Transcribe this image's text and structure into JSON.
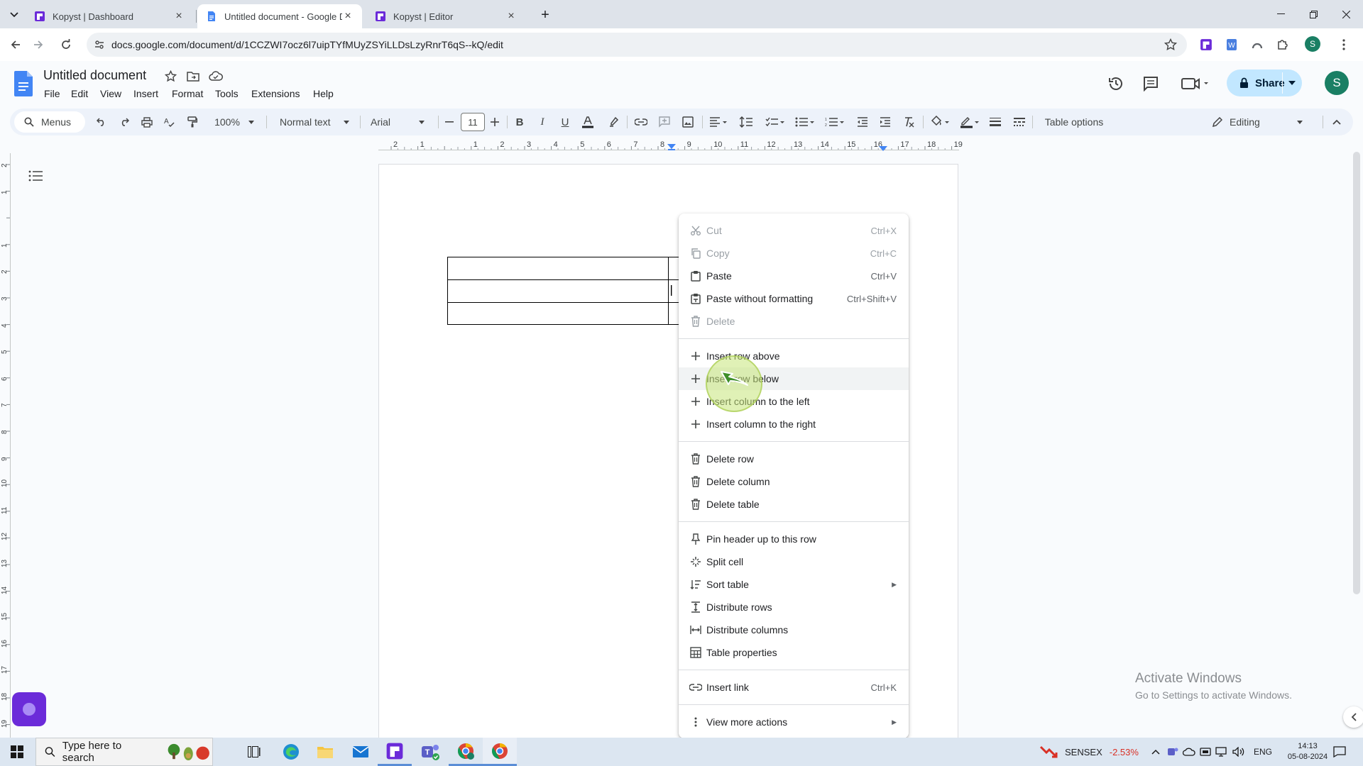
{
  "browser": {
    "tabs": [
      {
        "title": "Kopyst | Dashboard",
        "icon": "kopyst-icon",
        "active": false
      },
      {
        "title": "Untitled document - Google Docs",
        "icon": "google-docs-icon",
        "active": true
      },
      {
        "title": "Kopyst | Editor",
        "icon": "kopyst-icon",
        "active": false
      }
    ],
    "url": "docs.google.com/document/d/1CCZWI7ocz6l7uipTYfMUyZSYiLLDsLzyRnrT6qS--kQ/edit",
    "profile_initial": "S"
  },
  "docs": {
    "title": "Untitled document",
    "menus": [
      "File",
      "Edit",
      "View",
      "Insert",
      "Format",
      "Tools",
      "Extensions",
      "Help"
    ],
    "share_label": "Share",
    "avatar_initial": "S",
    "toolbar": {
      "menus_label": "Menus",
      "zoom": "100%",
      "style": "Normal text",
      "font": "Arial",
      "font_size": "11",
      "table_options": "Table options",
      "mode": "Editing"
    },
    "hruler_labels": [
      "2",
      "1",
      "",
      "1",
      "2",
      "3",
      "4",
      "5",
      "6",
      "7",
      "8",
      "9",
      "10",
      "11",
      "12",
      "13",
      "14",
      "15",
      "16",
      "17",
      "18",
      "19"
    ],
    "vruler_labels": [
      "2",
      "1",
      "",
      "1",
      "2",
      "3",
      "4",
      "5",
      "6",
      "7",
      "8",
      "9",
      "10",
      "11",
      "12",
      "13",
      "14",
      "15",
      "16",
      "17",
      "18",
      "19"
    ]
  },
  "context_menu": {
    "groups": [
      [
        {
          "label": "Cut",
          "shortcut": "Ctrl+X",
          "icon": "scissors-icon",
          "disabled": true
        },
        {
          "label": "Copy",
          "shortcut": "Ctrl+C",
          "icon": "copy-icon",
          "disabled": true
        },
        {
          "label": "Paste",
          "shortcut": "Ctrl+V",
          "icon": "paste-icon"
        },
        {
          "label": "Paste without formatting",
          "shortcut": "Ctrl+Shift+V",
          "icon": "paste-plain-icon"
        },
        {
          "label": "Delete",
          "shortcut": "",
          "icon": "trash-icon",
          "disabled": true
        }
      ],
      [
        {
          "label": "Insert row above",
          "icon": "plus-icon"
        },
        {
          "label": "Insert row below",
          "icon": "plus-icon",
          "highlighted": true
        },
        {
          "label": "Insert column to the left",
          "icon": "plus-icon"
        },
        {
          "label": "Insert column to the right",
          "icon": "plus-icon"
        }
      ],
      [
        {
          "label": "Delete row",
          "icon": "trash-icon"
        },
        {
          "label": "Delete column",
          "icon": "trash-icon"
        },
        {
          "label": "Delete table",
          "icon": "trash-icon"
        }
      ],
      [
        {
          "label": "Pin header up to this row",
          "icon": "pin-icon"
        },
        {
          "label": "Split cell",
          "icon": "split-cell-icon"
        },
        {
          "label": "Sort table",
          "icon": "sort-icon",
          "submenu": true
        },
        {
          "label": "Distribute rows",
          "icon": "distribute-rows-icon"
        },
        {
          "label": "Distribute columns",
          "icon": "distribute-columns-icon"
        },
        {
          "label": "Table properties",
          "icon": "table-icon"
        }
      ],
      [
        {
          "label": "Insert link",
          "shortcut": "Ctrl+K",
          "icon": "link-icon"
        }
      ],
      [
        {
          "label": "View more actions",
          "icon": "more-vertical-icon",
          "submenu": true
        }
      ]
    ]
  },
  "watermark": {
    "title": "Activate Windows",
    "subtitle": "Go to Settings to activate Windows."
  },
  "taskbar": {
    "search_placeholder": "Type here to search",
    "sensex_label": "SENSEX",
    "sensex_change": "-2.53%",
    "language": "ENG",
    "time": "14:13",
    "date": "05-08-2024"
  },
  "colors": {
    "accent_blue": "#0b57d0",
    "share_bg": "#c2e7ff",
    "kopyst_purple": "#6b2bd9",
    "docs_blue": "#4285f4",
    "cursor_highlight": "#c7e67a",
    "sensex_red": "#d93025"
  }
}
